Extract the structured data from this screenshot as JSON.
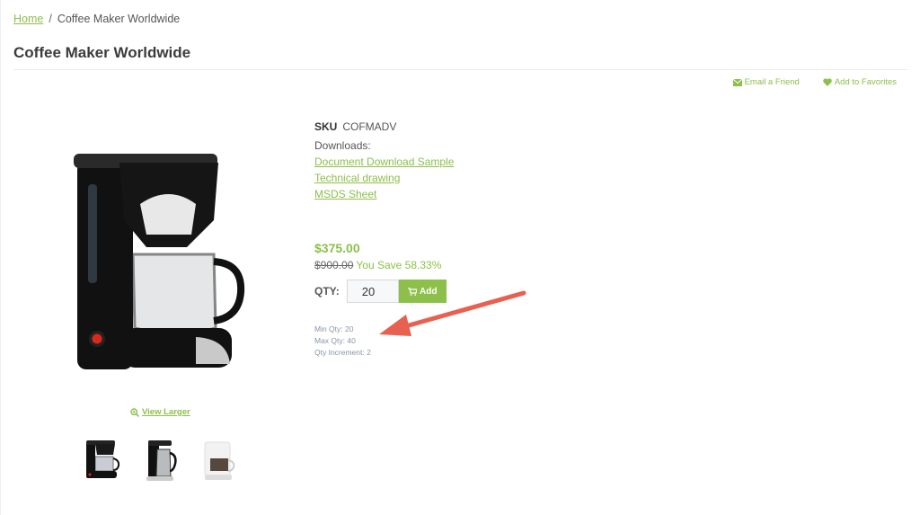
{
  "breadcrumb": {
    "home": "Home",
    "separator": "/",
    "current": "Coffee Maker Worldwide"
  },
  "page_title": "Coffee Maker Worldwide",
  "actions": {
    "email": {
      "label": "Email a Friend",
      "icon": "envelope-icon"
    },
    "favorites": {
      "label": "Add to Favorites",
      "icon": "heart-icon"
    }
  },
  "product": {
    "sku_label": "SKU",
    "sku": "COFMADV",
    "downloads_label": "Downloads:",
    "downloads": [
      "Document Download Sample",
      "Technical drawing",
      "MSDS Sheet"
    ],
    "price": "$375.00",
    "old_price": "$900.00",
    "savings": "You Save 58.33%",
    "qty_label": "QTY:",
    "qty_value": "20",
    "add_label": "Add",
    "min_qty": "Min Qty: 20",
    "max_qty": "Max Qty: 40",
    "qty_increment": "Qty Increment: 2",
    "view_larger": "View Larger",
    "thumbnails": [
      "black-coffee-maker",
      "stainless-coffee-maker",
      "white-coffee-maker"
    ]
  },
  "colors": {
    "accent": "#8cc04b",
    "annotation_arrow": "#e8604f"
  }
}
